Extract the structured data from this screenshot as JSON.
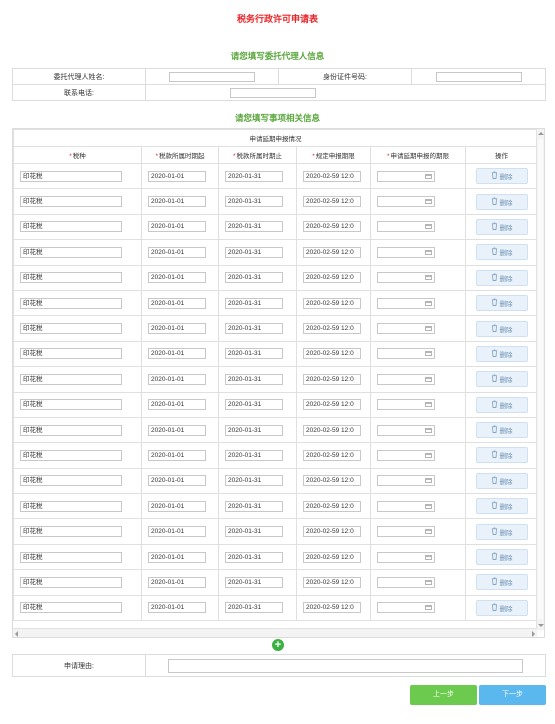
{
  "page": {
    "title": "税务行政许可申请表",
    "section_agent": "请您填写委托代理人信息",
    "section_items": "请您填写事项相关信息"
  },
  "agent": {
    "name_label": "委托代理人姓名:",
    "id_label": "身份证件号码:",
    "phone_label": "联系电话:",
    "name_value": "",
    "id_value": "",
    "phone_value": ""
  },
  "grid": {
    "caption": "申请延期申报情况",
    "headers": [
      "税种",
      "税款所属时期起",
      "税款所属时期止",
      "规定申报期限",
      "申请延期申报的期限",
      "操作"
    ],
    "required": [
      "*",
      "*",
      "*",
      "*",
      "*",
      ""
    ],
    "delete_label": "删除",
    "rows": [
      {
        "tax": "印花税",
        "start": "2020-01-01",
        "end": "2020-01-31",
        "deadline": "2020-02-59 12:0",
        "extend": ""
      },
      {
        "tax": "印花税",
        "start": "2020-01-01",
        "end": "2020-01-31",
        "deadline": "2020-02-59 12:0",
        "extend": ""
      },
      {
        "tax": "印花税",
        "start": "2020-01-01",
        "end": "2020-01-31",
        "deadline": "2020-02-59 12:0",
        "extend": ""
      },
      {
        "tax": "印花税",
        "start": "2020-01-01",
        "end": "2020-01-31",
        "deadline": "2020-02-59 12:0",
        "extend": ""
      },
      {
        "tax": "印花税",
        "start": "2020-01-01",
        "end": "2020-01-31",
        "deadline": "2020-02-59 12:0",
        "extend": ""
      },
      {
        "tax": "印花税",
        "start": "2020-01-01",
        "end": "2020-01-31",
        "deadline": "2020-02-59 12:0",
        "extend": ""
      },
      {
        "tax": "印花税",
        "start": "2020-01-01",
        "end": "2020-01-31",
        "deadline": "2020-02-59 12:0",
        "extend": ""
      },
      {
        "tax": "印花税",
        "start": "2020-01-01",
        "end": "2020-01-31",
        "deadline": "2020-02-59 12:0",
        "extend": ""
      },
      {
        "tax": "印花税",
        "start": "2020-01-01",
        "end": "2020-01-31",
        "deadline": "2020-02-59 12:0",
        "extend": ""
      },
      {
        "tax": "印花税",
        "start": "2020-01-01",
        "end": "2020-01-31",
        "deadline": "2020-02-59 12:0",
        "extend": ""
      },
      {
        "tax": "印花税",
        "start": "2020-01-01",
        "end": "2020-01-31",
        "deadline": "2020-02-59 12:0",
        "extend": ""
      },
      {
        "tax": "印花税",
        "start": "2020-01-01",
        "end": "2020-01-31",
        "deadline": "2020-02-59 12:0",
        "extend": ""
      },
      {
        "tax": "印花税",
        "start": "2020-01-01",
        "end": "2020-01-31",
        "deadline": "2020-02-59 12:0",
        "extend": ""
      },
      {
        "tax": "印花税",
        "start": "2020-01-01",
        "end": "2020-01-31",
        "deadline": "2020-02-59 12:0",
        "extend": ""
      },
      {
        "tax": "印花税",
        "start": "2020-01-01",
        "end": "2020-01-31",
        "deadline": "2020-02-59 12:0",
        "extend": ""
      },
      {
        "tax": "印花税",
        "start": "2020-01-01",
        "end": "2020-01-31",
        "deadline": "2020-02-59 12:0",
        "extend": ""
      },
      {
        "tax": "印花税",
        "start": "2020-01-01",
        "end": "2020-01-31",
        "deadline": "2020-02-59 12:0",
        "extend": ""
      },
      {
        "tax": "印花税",
        "start": "2020-01-01",
        "end": "2020-01-31",
        "deadline": "2020-02-59 12:0",
        "extend": ""
      }
    ]
  },
  "reason": {
    "label": "申请理由:",
    "value": ""
  },
  "buttons": {
    "prev": "上一步",
    "next": "下一步"
  },
  "colors": {
    "title": "#e8262a",
    "section": "#5aa53c",
    "prev_button": "#6ccb4f",
    "next_button": "#5bb8ee",
    "add_button": "#3cb043"
  },
  "icons": {
    "add": "plus-circle-icon",
    "delete": "trash-icon",
    "date_picker": "calendar-icon"
  }
}
